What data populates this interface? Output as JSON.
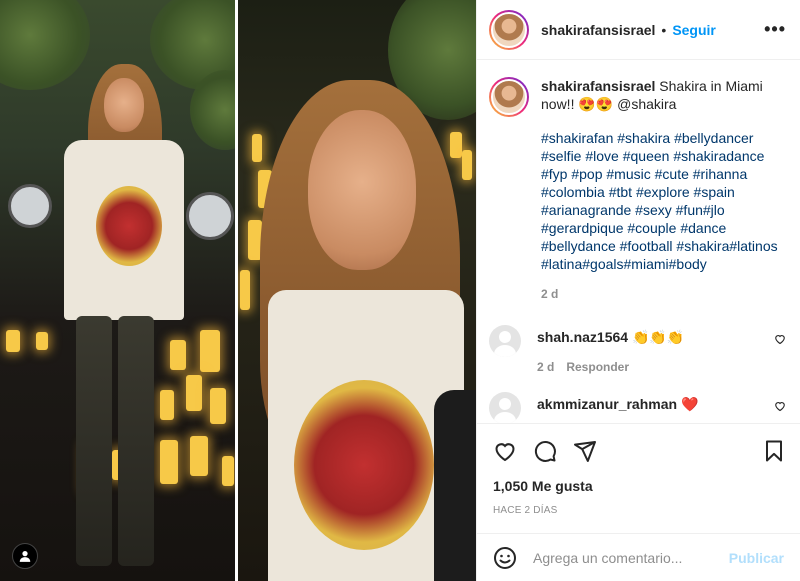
{
  "header": {
    "username": "shakirafansisrael",
    "separator": "•",
    "follow_label": "Seguir",
    "more_label": "•••",
    "more_icon": "more-options-icon"
  },
  "caption": {
    "username": "shakirafansisrael",
    "text": "Shakira in Miami now!! 😍😍 @shakira",
    "hashtags": "#shakirafan #shakira #bellydancer #selfie #love #queen #shakiradance #fyp #pop #music #cute #rihanna #colombia #tbt #explore #spain #arianagrande #sexy #fun#jlo #gerardpique #couple #dance #bellydance #football #shakira#latinos #latina#goals#miami#body",
    "age": "2 d"
  },
  "comments": [
    {
      "username": "shah.naz1564",
      "text": "👏👏👏",
      "age": "2 d",
      "reply_label": "Responder"
    },
    {
      "username": "akmmizanur_rahman",
      "text": "❤️"
    }
  ],
  "actions": {
    "like_icon": "heart-icon",
    "comment_icon": "comment-icon",
    "share_icon": "share-icon",
    "save_icon": "bookmark-icon"
  },
  "likes_text": "1,050 Me gusta",
  "posted_ago": "HACE 2 DÍAS",
  "add_comment": {
    "placeholder": "Agrega un comentario...",
    "post_label": "Publicar",
    "emoji_icon": "emoji-icon"
  },
  "colors": {
    "link_blue": "#0095f6",
    "hashtag_blue": "#00376b",
    "muted_gray": "#8e8e8e",
    "post_button_disabled": "#b2dffc"
  }
}
